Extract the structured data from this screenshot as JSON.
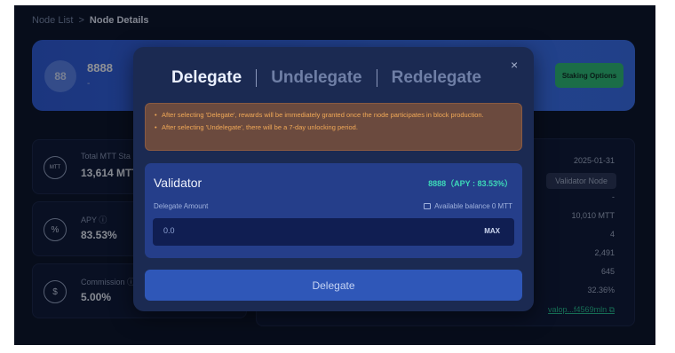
{
  "breadcrumb": {
    "parent": "Node List",
    "separator": ">",
    "current": "Node Details"
  },
  "node": {
    "avatar_text": "88",
    "name": "8888",
    "subtitle": "-",
    "staking_button": "Staking Options"
  },
  "stats": [
    {
      "icon": "mtt-coin-icon",
      "icon_text": "MTT",
      "label": "Total MTT Sta",
      "value": "13,614 MTT"
    },
    {
      "icon": "percent-icon",
      "icon_text": "%",
      "label": "APY ⓘ",
      "value": "83.53%"
    },
    {
      "icon": "dollar-icon",
      "icon_text": "$",
      "label": "Commission ⓘ",
      "value": "5.00%"
    }
  ],
  "details": {
    "date": "2025-01-31",
    "type_badge": "Validator Node",
    "dash": "-",
    "values": [
      "10,010 MTT",
      "4",
      "2,491",
      "645",
      "32.36%"
    ],
    "address_link": "valop...f4569mln ⧉"
  },
  "modal": {
    "tabs": [
      {
        "label": "Delegate",
        "active": true
      },
      {
        "label": "Undelegate",
        "active": false
      },
      {
        "label": "Redelegate",
        "active": false
      }
    ],
    "close_symbol": "×",
    "notices": [
      "After selecting 'Delegate', rewards will be immediately granted once the node participates in block production.",
      "After selecting 'Undelegate', there will be a 7-day unlocking period."
    ],
    "validator": {
      "title": "Validator",
      "apy_text": "8888（APY : 83.53%）",
      "amount_label": "Delegate Amount",
      "balance_text": "Available balance 0 MTT",
      "amount_placeholder": "0.0",
      "max_label": "MAX"
    },
    "submit_label": "Delegate"
  },
  "colors": {
    "accent": "#3b71f0",
    "success": "#2fbf71",
    "apy": "#3dd9b8",
    "warning": "#f0a857"
  }
}
